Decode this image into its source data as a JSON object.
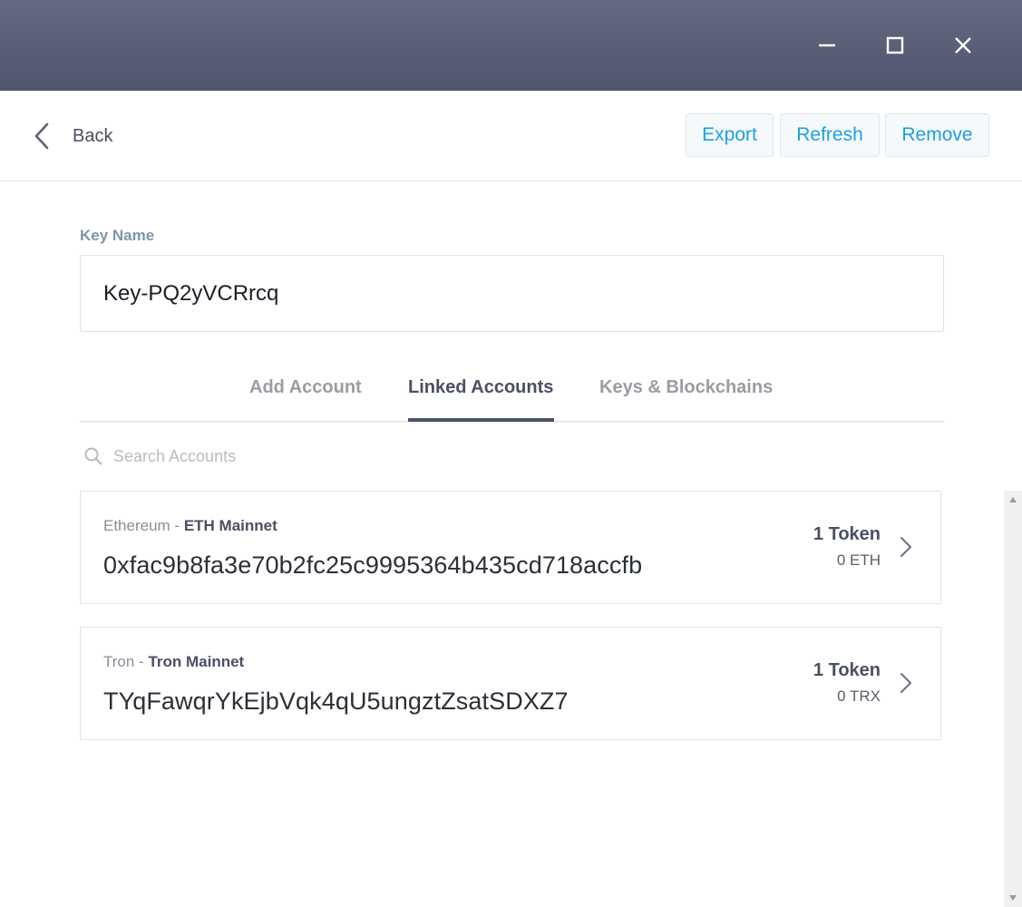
{
  "window": {
    "minimize_icon": "minimize-icon",
    "maximize_icon": "maximize-icon",
    "close_icon": "close-icon"
  },
  "header": {
    "back_label": "Back",
    "export_label": "Export",
    "refresh_label": "Refresh",
    "remove_label": "Remove"
  },
  "key": {
    "label": "Key Name",
    "value": "Key-PQ2yVCRrcq"
  },
  "tabs": [
    {
      "label": "Add Account",
      "active": false
    },
    {
      "label": "Linked Accounts",
      "active": true
    },
    {
      "label": "Keys & Blockchains",
      "active": false
    }
  ],
  "search": {
    "placeholder": "Search Accounts",
    "value": ""
  },
  "accounts": [
    {
      "blockchain": "Ethereum",
      "separator": " - ",
      "network": "ETH Mainnet",
      "address": "0xfac9b8fa3e70b2fc25c9995364b435cd718accfb",
      "tokens": "1 Token",
      "balance": "0 ETH"
    },
    {
      "blockchain": "Tron",
      "separator": " - ",
      "network": "Tron Mainnet",
      "address": "TYqFawqrYkEjbVqk4qU5ungztZsatSDXZ7",
      "tokens": "1 Token",
      "balance": "0 TRX"
    }
  ],
  "colors": {
    "titlebar": "#565d75",
    "accent": "#1aa0e6",
    "tab_active": "#4e5468",
    "label": "#7a97a5"
  }
}
